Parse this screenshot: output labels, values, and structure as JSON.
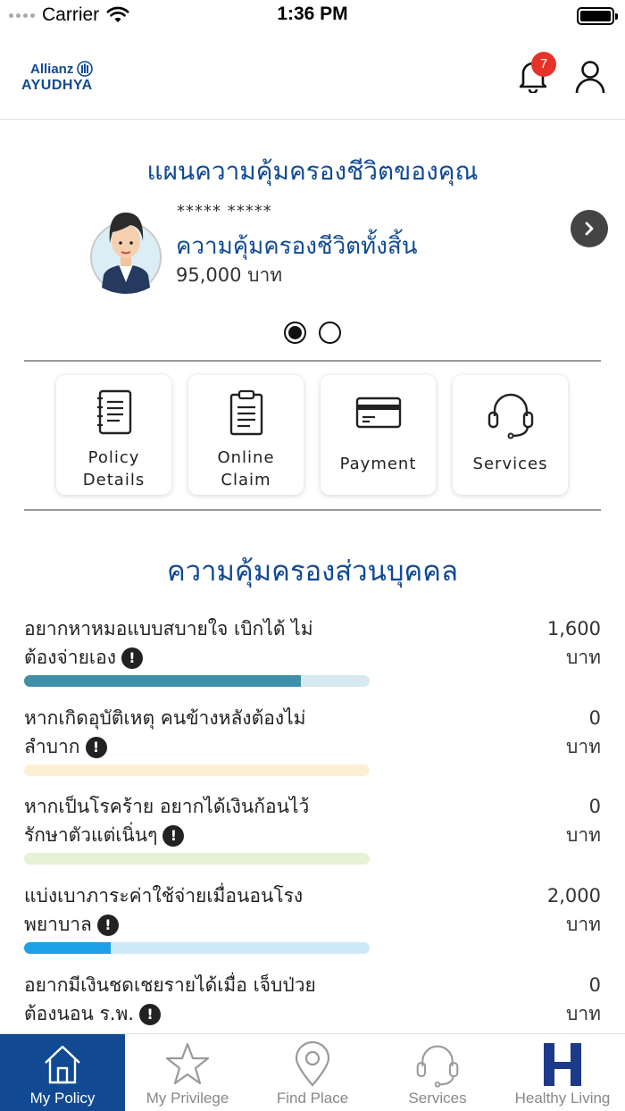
{
  "status_bar": {
    "carrier": "Carrier",
    "time": "1:36 PM"
  },
  "header": {
    "logo_top": "Allianz",
    "logo_bottom": "AYUDHYA",
    "notification_count": "7"
  },
  "plan": {
    "title": "แผนความคุ้มครองชีวิตของคุณ",
    "policy_holder": "***** *****",
    "coverage_label": "ความคุ้มครองชีวิตทั้งสิ้น",
    "coverage_amount": "95,000 บาท",
    "page_count": 2,
    "active_page": 1
  },
  "actions": [
    {
      "line1": "Policy",
      "line2": "Details",
      "icon": "notebook-icon"
    },
    {
      "line1": "Online",
      "line2": "Claim",
      "icon": "clipboard-icon"
    },
    {
      "line1": "Payment",
      "icon": "credit-card-icon"
    },
    {
      "line1": "Services",
      "icon": "headset-icon"
    }
  ],
  "personal": {
    "title": "ความคุ้มครองส่วนบุคคล",
    "items": [
      {
        "line1": "อยากหาหมอแบบสบายใจ เบิกได้ ไม่",
        "line2": "ต้องจ่ายเอง",
        "value": "1,600",
        "unit": "บาท",
        "fill_fraction": 0.8,
        "fill_color": "#3f8fa8",
        "track_color": "#d6e9f0"
      },
      {
        "line1": "หากเกิดอุบัติเหตุ คนข้างหลังต้องไม่",
        "line2": "ลำบาก",
        "value": "0",
        "unit": "บาท",
        "fill_fraction": 0,
        "fill_color": "#f5d58a",
        "track_color": "#fdf0d2"
      },
      {
        "line1": "หากเป็นโรคร้าย อยากได้เงินก้อนไว้",
        "line2": "รักษาตัวแต่เนิ่นๆ",
        "value": "0",
        "unit": "บาท",
        "fill_fraction": 0,
        "fill_color": "#b9d98a",
        "track_color": "#e6f2d4"
      },
      {
        "line1": "แบ่งเบาภาระค่าใช้จ่ายเมื่อนอนโรง",
        "line2": "พยาบาล",
        "value": "2,000",
        "unit": "บาท",
        "fill_fraction": 0.25,
        "fill_color": "#1ea0e6",
        "track_color": "#cde9f7"
      },
      {
        "line1": "อยากมีเงินชดเชยรายได้เมื่อ เจ็บป่วย",
        "line2": "ต้องนอน ร.พ.",
        "value": "0",
        "unit": "บาท",
        "fill_fraction": 0,
        "fill_color": "#cccccc",
        "track_color": "#eeeeee"
      }
    ]
  },
  "tabs": [
    {
      "label": "My Policy",
      "icon": "house-icon",
      "active": true
    },
    {
      "label": "My Privilege",
      "icon": "star-icon",
      "active": false
    },
    {
      "label": "Find Place",
      "icon": "map-pin-icon",
      "active": false
    },
    {
      "label": "Services",
      "icon": "headset-icon",
      "active": false
    },
    {
      "label": "Healthy Living",
      "icon": "healthy-living-logo-icon",
      "active": false
    }
  ],
  "colors": {
    "brand": "#114a93",
    "badge": "#e63329"
  }
}
